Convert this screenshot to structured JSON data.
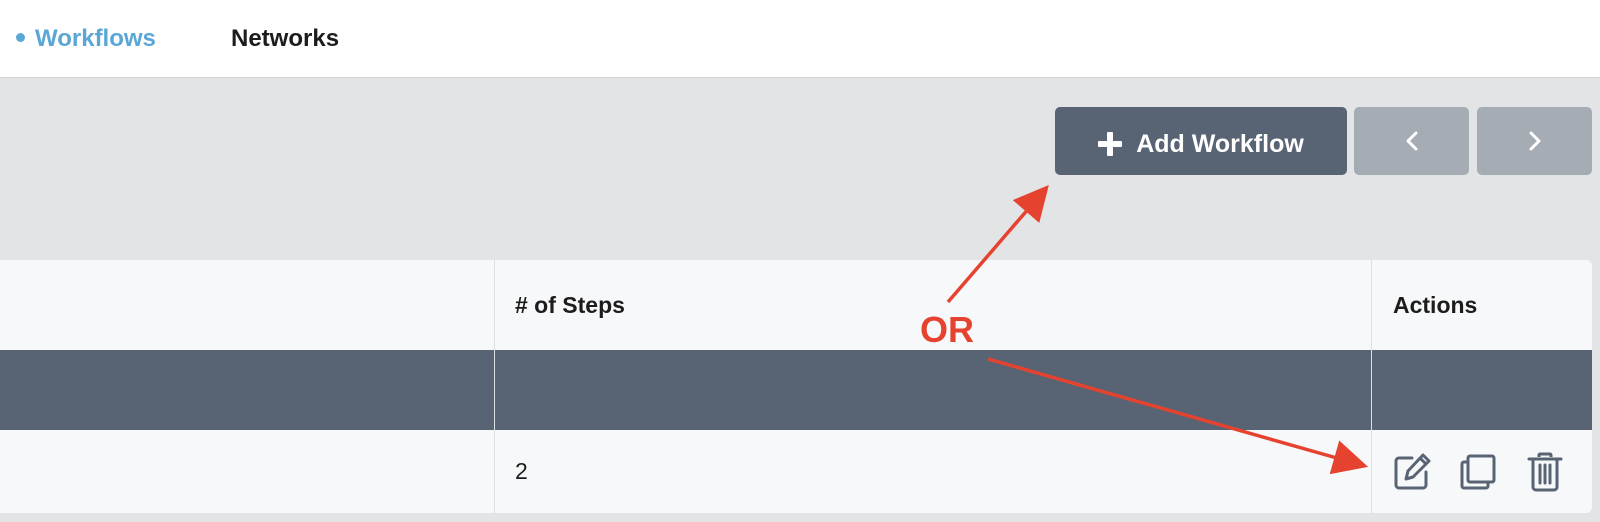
{
  "nav": {
    "tabs": [
      {
        "label": "Workflows",
        "active": true
      },
      {
        "label": "Networks",
        "active": false
      }
    ]
  },
  "toolbar": {
    "add_label": "Add Workflow",
    "prev_icon": "chevron-left-icon",
    "next_icon": "chevron-right-icon"
  },
  "table": {
    "headers": {
      "steps": "# of Steps",
      "actions": "Actions"
    },
    "rows": [
      {
        "steps": "2",
        "actions": [
          "edit-icon",
          "copy-icon",
          "trash-icon"
        ]
      }
    ]
  },
  "annotation": {
    "label": "OR",
    "color": "#e5432f"
  },
  "colors": {
    "accent": "#5aa7d6",
    "primary_button": "#586474",
    "disabled_button": "#a5acb4",
    "background": "#e3e4e6"
  }
}
